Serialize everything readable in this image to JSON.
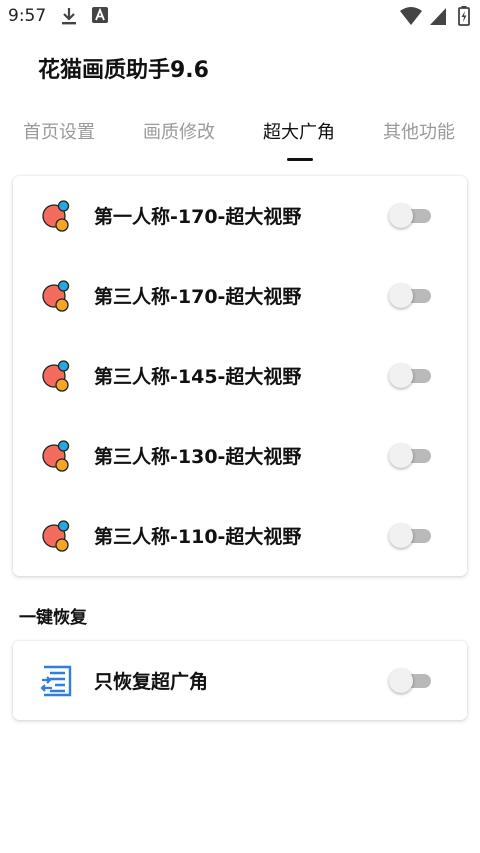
{
  "status_bar": {
    "time": "9:57",
    "left_icons": [
      "download-icon",
      "font-a-icon"
    ],
    "right_icons": [
      "wifi-icon",
      "cell-signal-icon",
      "battery-charging-icon"
    ]
  },
  "app": {
    "title": "花猫画质助手9.6"
  },
  "tabs": [
    {
      "label": "首页设置",
      "active": false
    },
    {
      "label": "画质修改",
      "active": false
    },
    {
      "label": "超大广角",
      "active": true
    },
    {
      "label": "其他功能",
      "active": false
    }
  ],
  "wide_angle": {
    "items": [
      {
        "label": "第一人称-170-超大视野",
        "on": false,
        "icon": "bubbles-icon"
      },
      {
        "label": "第三人称-170-超大视野",
        "on": false,
        "icon": "bubbles-icon"
      },
      {
        "label": "第三人称-145-超大视野",
        "on": false,
        "icon": "bubbles-icon"
      },
      {
        "label": "第三人称-130-超大视野",
        "on": false,
        "icon": "bubbles-icon"
      },
      {
        "label": "第三人称-110-超大视野",
        "on": false,
        "icon": "bubbles-icon"
      }
    ]
  },
  "restore": {
    "section_title": "一键恢复",
    "items": [
      {
        "label": "只恢复超广角",
        "on": false,
        "icon": "restore-list-icon"
      }
    ]
  },
  "colors": {
    "bubble_red": "#f26b5b",
    "bubble_orange": "#f5a623",
    "bubble_blue": "#29a8e0",
    "restore_icon_blue": "#2f7fe0",
    "toggle_track_off": "#b9b9b9",
    "toggle_thumb_off": "#f1f1f1"
  }
}
